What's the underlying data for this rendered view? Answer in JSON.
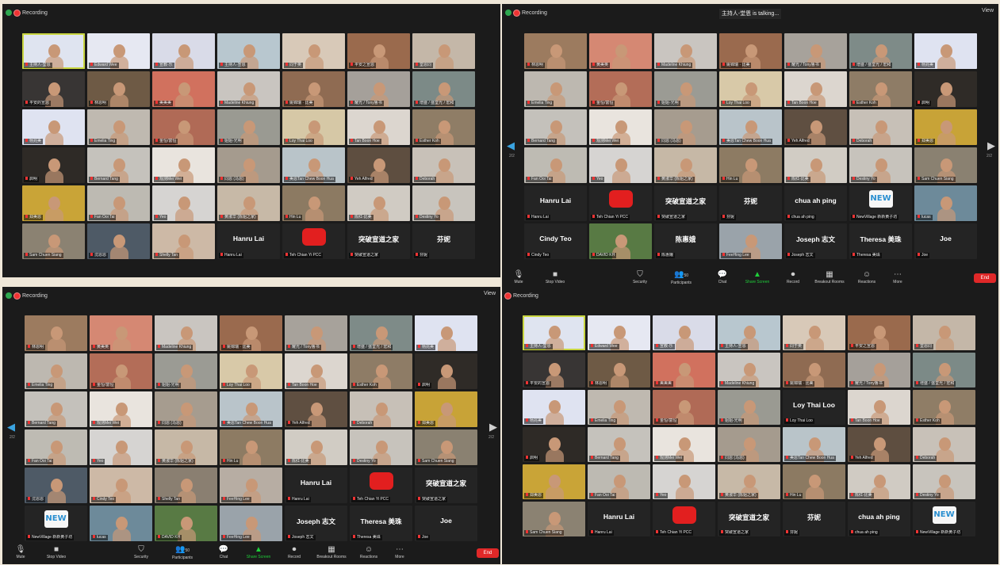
{
  "recording_label": "Recording",
  "view_label": "View",
  "talking_label": "主持人-堂恩 is talking...",
  "toolbar": {
    "mute": "Mute",
    "stop_video": "Stop Video",
    "security": "Security",
    "participants": "Participants",
    "participants_count": "50",
    "chat": "Chat",
    "share_screen": "Share Screen",
    "record": "Record",
    "breakout_rooms": "Breakout Rooms",
    "reactions": "Reactions",
    "more": "More",
    "end": "End"
  },
  "pager": {
    "q2": "2/2",
    "q3": "2/2"
  },
  "galleries": {
    "q1": [
      {
        "n": "主持人-堂恩",
        "c": "#dfe4f0"
      },
      {
        "n": "Edward Wee",
        "c": "#e6e8f2"
      },
      {
        "n": "宣教-乐",
        "c": "#d9dbe8"
      },
      {
        "n": "主持人-宣恩",
        "c": "#b8c7cf"
      },
      {
        "n": "同于英",
        "c": "#d8c9b8"
      },
      {
        "n": "平安之宣恩",
        "c": "#9a6a4d"
      },
      {
        "n": "堂恩同",
        "c": "#c4b7a8"
      },
      {
        "n": "平安的宣恩",
        "c": "#383534"
      },
      {
        "n": "林恩明",
        "c": "#6e5a45"
      },
      {
        "n": "美美美",
        "c": "#d1715e"
      },
      {
        "n": "Madeline Khiung",
        "c": "#c9c5c0"
      },
      {
        "n": "姚锦瑞 · 比美",
        "c": "#8f6b52"
      },
      {
        "n": "耀光 / Tony鲁书",
        "c": "#a5a09a"
      },
      {
        "n": "增盛 / 盛堂光 / 宏和",
        "c": "#7c8a87"
      },
      {
        "n": "杨兆美",
        "c": "#dfe3f1"
      },
      {
        "n": "Emelia Ting",
        "c": "#bfb9b0"
      },
      {
        "n": "金恒/富恒",
        "c": "#b06a56"
      },
      {
        "n": "姐姐-光明",
        "c": "#9a9a92"
      },
      {
        "n": "Loy Thai Loo",
        "c": "#d6c8a6"
      },
      {
        "n": "Tan Boon Hoe",
        "c": "#dcd6cf"
      },
      {
        "n": "Esther Koh",
        "c": "#8f7d66"
      },
      {
        "n": "启明",
        "c": "#2e2a26"
      },
      {
        "n": "Bernard Tang",
        "c": "#c5c2bc"
      },
      {
        "n": "观测Mei Wei",
        "c": "#e9e4de"
      },
      {
        "n": "同恩 (马恩)",
        "c": "#a59b8e"
      },
      {
        "n": "美恩Tan Chew Boon Hua",
        "c": "#b9c4c9"
      },
      {
        "n": "Yeh Alfred",
        "c": "#5e4e40"
      },
      {
        "n": "Deborah",
        "c": "#c8c1b8"
      },
      {
        "n": "郑美恩",
        "c": "#c9a437"
      },
      {
        "n": "Fan Ooi Tai",
        "c": "#bdbab2"
      },
      {
        "n": "Yeo",
        "c": "#d6d4d2"
      },
      {
        "n": "黄淑华 (陈姐之家)",
        "c": "#c7b9a7"
      },
      {
        "n": "Hin Lu",
        "c": "#8c7a62"
      },
      {
        "n": "陈红-比美",
        "c": "#d0cbc3"
      },
      {
        "n": "Destiny Yo",
        "c": "#c8c4bd"
      },
      {
        "n": "Sam Chuen Siang",
        "c": "#8b8272"
      },
      {
        "n": "沈恩恩",
        "c": "#4e5a66"
      },
      {
        "n": "Shelly Tan",
        "c": "#cdb9a6"
      },
      {
        "n": "Hanru Lai",
        "t": "Hanru Lai"
      },
      {
        "n": "Teh Chian Yi PCC",
        "th": "gift"
      },
      {
        "n": "突破宣道之家",
        "t": "突破宣道之家"
      },
      {
        "n": "芬妮",
        "t": "芬妮"
      }
    ],
    "q2": [
      {
        "n": "林恩明",
        "c": "#9c7b5f"
      },
      {
        "n": "黄美英",
        "c": "#d58873"
      },
      {
        "n": "Madeline Khiung",
        "c": "#c9c5c0"
      },
      {
        "n": "姚锦瑞 · 比美",
        "c": "#9a6a4e"
      },
      {
        "n": "耀光 / Tony鲁书",
        "c": "#a7a29b"
      },
      {
        "n": "增盛 / 盛堂光 / 宏和",
        "c": "#7e8b88"
      },
      {
        "n": "杨兆美",
        "c": "#dfe3f1"
      },
      {
        "n": "Emelia Ting",
        "c": "#bdb8b0"
      },
      {
        "n": "金恒/富恒",
        "c": "#b36d58"
      },
      {
        "n": "姐姐-光明",
        "c": "#9b9b94"
      },
      {
        "n": "Loy Thai Loo",
        "c": "#d8c9a8"
      },
      {
        "n": "Tan Boon Hoe",
        "c": "#dcd6cf"
      },
      {
        "n": "Esther Koh",
        "c": "#8e7c66"
      },
      {
        "n": "启明",
        "c": "#2f2b27"
      },
      {
        "n": "Bernard Tang",
        "c": "#c4c1bb"
      },
      {
        "n": "观测Mei Wei",
        "c": "#e9e4de"
      },
      {
        "n": "同恩 (马恩)",
        "c": "#a69c8f"
      },
      {
        "n": "美恩Tan Chew Boon Hua",
        "c": "#b9c4ca"
      },
      {
        "n": "Yeh Alfred",
        "c": "#5f4f41"
      },
      {
        "n": "Deborah",
        "c": "#c7c0b7"
      },
      {
        "n": "郑美恩",
        "c": "#c8a337"
      },
      {
        "n": "Fan Ooi Tai",
        "c": "#bebbb3"
      },
      {
        "n": "Yeo",
        "c": "#d6d4d2"
      },
      {
        "n": "黄淑华 (陈姐之家)",
        "c": "#c6b8a6"
      },
      {
        "n": "Hin Lu",
        "c": "#8d7b63"
      },
      {
        "n": "陈红-比美",
        "c": "#d1ccc4"
      },
      {
        "n": "Destiny Yo",
        "c": "#c7c3bc"
      },
      {
        "n": "Sam Chuen Siang",
        "c": "#8a8171"
      },
      {
        "n": "Hanru Lai",
        "t": "Hanru Lai"
      },
      {
        "n": "Teh Chian Yi PCC",
        "th": "gift"
      },
      {
        "n": "突破宣道之家",
        "t": "突破宣道之家"
      },
      {
        "n": "芬妮",
        "t": "芬妮"
      },
      {
        "n": "chua ah ping",
        "t": "chua ah ping"
      },
      {
        "n": "NewVillage 新新黄子坊",
        "th": "new"
      },
      {
        "n": "lucas",
        "c": "#6d8a9a"
      },
      {
        "n": "Cindy Teo",
        "t": "Cindy Teo"
      },
      {
        "n": "DAVID KH",
        "c": "#587a44"
      },
      {
        "n": "陈惠娥",
        "t": "陈惠娥"
      },
      {
        "n": "FeeHing Lee",
        "c": "#9aa3aa"
      },
      {
        "n": "Joseph 志文",
        "t": "Joseph 志文"
      },
      {
        "n": "Theresa 美珠",
        "t": "Theresa 美珠"
      },
      {
        "n": "Joe",
        "t": "Joe"
      }
    ],
    "q3": [
      {
        "n": "林恩明",
        "c": "#9c7b5f"
      },
      {
        "n": "黄美英",
        "c": "#d58873"
      },
      {
        "n": "Madeline Khiung",
        "c": "#c9c5c0"
      },
      {
        "n": "姚锦瑞 · 比美",
        "c": "#9a6a4e"
      },
      {
        "n": "耀光 / Tony鲁书",
        "c": "#a7a29b"
      },
      {
        "n": "增盛 / 盛堂光 / 宏和",
        "c": "#7e8b88"
      },
      {
        "n": "杨兆美",
        "c": "#dfe3f1"
      },
      {
        "n": "Emelia Ting",
        "c": "#bdb8b0"
      },
      {
        "n": "金恒/富恒",
        "c": "#b36d58"
      },
      {
        "n": "姐姐-光明",
        "c": "#9b9b94"
      },
      {
        "n": "Loy Thai Loo",
        "c": "#d8c9a8"
      },
      {
        "n": "Tan Boon Hoe",
        "c": "#dcd6cf"
      },
      {
        "n": "Esther Koh",
        "c": "#8e7c66"
      },
      {
        "n": "启明",
        "c": "#2f2b27"
      },
      {
        "n": "Bernard Tang",
        "c": "#c4c1bb"
      },
      {
        "n": "观测Mei Wei",
        "c": "#e9e4de"
      },
      {
        "n": "同恩 (马恩)",
        "c": "#a69c8f"
      },
      {
        "n": "美恩Tan Chew Boon Hua",
        "c": "#b9c4ca"
      },
      {
        "n": "Yeh Alfred",
        "c": "#5f4f41"
      },
      {
        "n": "Deborah",
        "c": "#c7c0b7"
      },
      {
        "n": "郑美恩",
        "c": "#c8a337"
      },
      {
        "n": "Fan Ooi Tai",
        "c": "#bebbb3"
      },
      {
        "n": "Yeo",
        "c": "#d6d4d2"
      },
      {
        "n": "黄淑华 (陈姐之家)",
        "c": "#c6b8a6"
      },
      {
        "n": "Hin Lu",
        "c": "#8d7b63"
      },
      {
        "n": "陈红-比美",
        "c": "#d1ccc4"
      },
      {
        "n": "Destiny Yo",
        "c": "#c7c3bc"
      },
      {
        "n": "Sam Chuen Siang",
        "c": "#8a8171"
      },
      {
        "n": "沈恩恩",
        "c": "#4e5a66"
      },
      {
        "n": "Cindy Teo",
        "c": "#cdb9a6"
      },
      {
        "n": "Shelly Tan",
        "c": "#8a7f71"
      },
      {
        "n": "FeeHing Lee",
        "c": "#b7ada3"
      },
      {
        "n": "Hanru Lai",
        "t": "Hanru Lai"
      },
      {
        "n": "Teh Chian Yi PCC",
        "th": "gift"
      },
      {
        "n": "突破宣道之家",
        "t": "突破宣道之家"
      },
      {
        "n": "NewVillage 新新黄子坊",
        "th": "new"
      },
      {
        "n": "lucas",
        "c": "#6d8a9a"
      },
      {
        "n": "DAVID KH",
        "c": "#587a44"
      },
      {
        "n": "FeeHing Lee",
        "c": "#9aa3aa"
      },
      {
        "n": "Joseph 志文",
        "t": "Joseph 志文"
      },
      {
        "n": "Theresa 美珠",
        "t": "Theresa 美珠"
      },
      {
        "n": "Joe",
        "t": "Joe"
      }
    ],
    "q4": [
      {
        "n": "主持人-堂恩",
        "c": "#dfe4f0"
      },
      {
        "n": "Edward Wee",
        "c": "#e6e8f2"
      },
      {
        "n": "宣教-乐",
        "c": "#d9dbe8"
      },
      {
        "n": "主持人-宣恩",
        "c": "#b8c7cf"
      },
      {
        "n": "同于英",
        "c": "#d8c9b8"
      },
      {
        "n": "平安之宣恩",
        "c": "#9a6a4d"
      },
      {
        "n": "堂恩同",
        "c": "#c4b7a8"
      },
      {
        "n": "平安的宣恩",
        "c": "#383534"
      },
      {
        "n": "林恩明",
        "c": "#6e5a45"
      },
      {
        "n": "美美美",
        "c": "#d1715e"
      },
      {
        "n": "Madeline Khiung",
        "c": "#c9c5c0"
      },
      {
        "n": "姚锦瑞 · 比美",
        "c": "#8f6b52"
      },
      {
        "n": "耀光 / Tony鲁书",
        "c": "#a5a09a"
      },
      {
        "n": "增盛 / 盛堂光 / 宏和",
        "c": "#7c8a87"
      },
      {
        "n": "杨兆美",
        "c": "#dfe3f1"
      },
      {
        "n": "Emelia Ting",
        "c": "#bfb9b0"
      },
      {
        "n": "金恒/富恒",
        "c": "#b06a56"
      },
      {
        "n": "姐姐-光明",
        "c": "#9a9a92"
      },
      {
        "n": "Loy Thai Loo",
        "t": "Loy Thai Loo"
      },
      {
        "n": "Tan Boon Hoe",
        "c": "#dcd6cf"
      },
      {
        "n": "Esther Koh",
        "c": "#8f7d66"
      },
      {
        "n": "启明",
        "c": "#2e2a26"
      },
      {
        "n": "Bernard Tang",
        "c": "#c5c2bc"
      },
      {
        "n": "观测Mei Wei",
        "c": "#e9e4de"
      },
      {
        "n": "同恩 (马恩)",
        "c": "#a59b8e"
      },
      {
        "n": "美恩Tan Chew Boon Hua",
        "c": "#b9c4c9"
      },
      {
        "n": "Yeh Alfred",
        "c": "#5e4e40"
      },
      {
        "n": "Deborah",
        "c": "#c8c1b8"
      },
      {
        "n": "郑美恩",
        "c": "#c9a437"
      },
      {
        "n": "Fan Ooi Tai",
        "c": "#bdbab2"
      },
      {
        "n": "Yeo",
        "c": "#d6d4d2"
      },
      {
        "n": "黄淑华 (陈姐之家)",
        "c": "#c7b9a7"
      },
      {
        "n": "Hin Lu",
        "c": "#8c7a62"
      },
      {
        "n": "陈红-比美",
        "c": "#d0cbc3"
      },
      {
        "n": "Destiny Yo",
        "c": "#c8c4bd"
      },
      {
        "n": "Sam Chuen Siang",
        "c": "#8b8272"
      },
      {
        "n": "Hanru Lai",
        "t": "Hanru Lai"
      },
      {
        "n": "Teh Chian Yi PCC",
        "th": "gift"
      },
      {
        "n": "突破宣道之家",
        "t": "突破宣道之家"
      },
      {
        "n": "芬妮",
        "t": "芬妮"
      },
      {
        "n": "chua ah ping",
        "t": "chua ah ping"
      },
      {
        "n": "NewVillage 新新黄子坊",
        "th": "new"
      }
    ]
  }
}
